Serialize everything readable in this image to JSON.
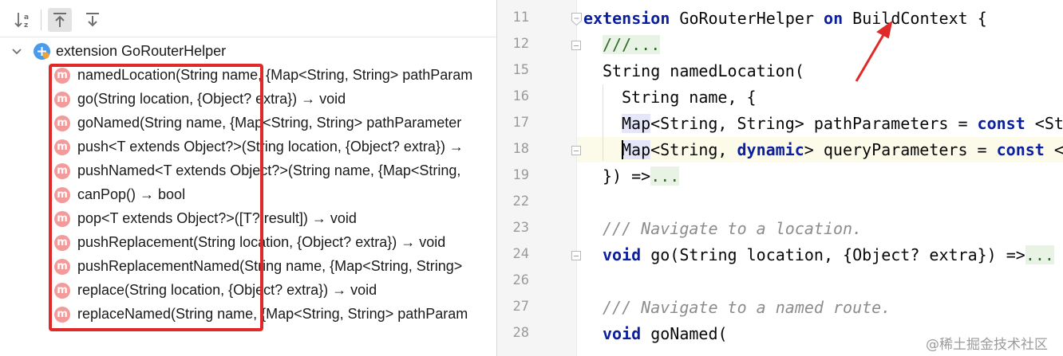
{
  "structure": {
    "toolbar": {
      "sort_icon": "sort-alphabetically-icon",
      "up_icon": "navigate-up-icon",
      "down_icon": "navigate-down-icon"
    },
    "root": {
      "label": "extension GoRouterHelper",
      "icon": "extension-icon"
    },
    "member_icon_letter": "m",
    "members": [
      "namedLocation(String name, {Map<String, String> pathParam",
      "go(String location, {Object? extra}) → void",
      "goNamed(String name, {Map<String, String> pathParameter",
      "push<T extends Object?>(String location, {Object? extra}) →",
      "pushNamed<T extends Object?>(String name, {Map<String,",
      "canPop() → bool",
      "pop<T extends Object?>([T? result]) → void",
      "pushReplacement(String location, {Object? extra}) → void",
      "pushReplacementNamed(String name, {Map<String, String>",
      "replace(String location, {Object? extra}) → void",
      "replaceNamed(String name, {Map<String, String> pathParam"
    ]
  },
  "editor": {
    "line_numbers": [
      "11",
      "12",
      "15",
      "16",
      "17",
      "18",
      "19",
      "22",
      "23",
      "24",
      "26",
      "27",
      "28"
    ],
    "lines": {
      "l11": {
        "kw1": "extension",
        "t1": " GoRouterHelper ",
        "kw2": "on",
        "t2": " BuildContext {"
      },
      "l12": {
        "fold": "///..."
      },
      "l15": {
        "t": "String namedLocation("
      },
      "l16": {
        "t": "String name, {"
      },
      "l17": {
        "map": "Map",
        "t1": "<String, String> pathParameters = ",
        "kw": "const",
        "t2": " <St"
      },
      "l18": {
        "map": "Map",
        "t1": "<String, ",
        "kw1": "dynamic",
        "t2": "> queryParameters = ",
        "kw2": "const",
        "t3": " <"
      },
      "l19": {
        "t": "}) =>",
        "fold": "..."
      },
      "l23": {
        "cm": "/// Navigate to a location."
      },
      "l24": {
        "kw": "void",
        "t": " go(String location, {Object? extra}) =>",
        "fold": "..."
      },
      "l27": {
        "cm": "/// Navigate to a named route."
      },
      "l28": {
        "kw": "void",
        "t": " goNamed("
      }
    }
  },
  "annotation": {
    "highlight_color": "#e02a2a"
  },
  "watermark": "@稀土掘金技术社区"
}
